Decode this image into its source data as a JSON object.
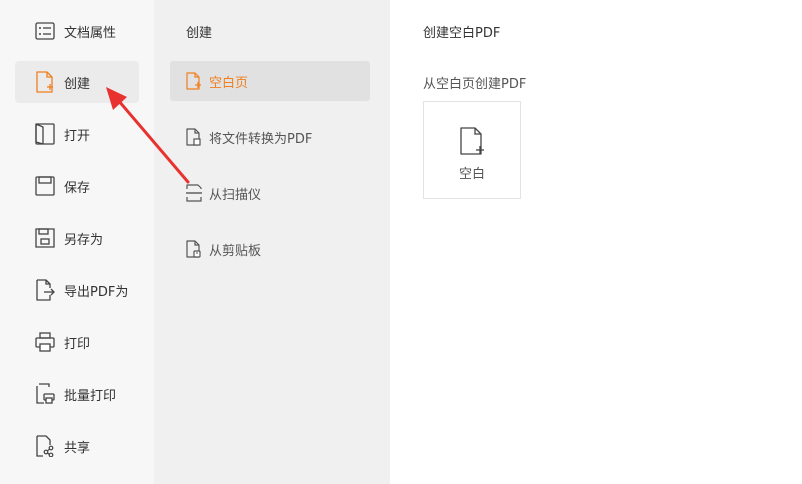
{
  "sidebar": {
    "items": [
      {
        "label": "文档属性",
        "icon": "document-properties-icon"
      },
      {
        "label": "创建",
        "icon": "create-file-icon",
        "active": true
      },
      {
        "label": "打开",
        "icon": "open-book-icon"
      },
      {
        "label": "保存",
        "icon": "save-icon"
      },
      {
        "label": "另存为",
        "icon": "save-as-icon"
      },
      {
        "label": "导出PDF为",
        "icon": "export-icon"
      },
      {
        "label": "打印",
        "icon": "print-icon"
      },
      {
        "label": "批量打印",
        "icon": "batch-print-icon"
      },
      {
        "label": "共享",
        "icon": "share-icon"
      }
    ]
  },
  "submenu": {
    "title": "创建",
    "items": [
      {
        "label": "空白页",
        "icon": "blank-page-icon",
        "active": true
      },
      {
        "label": "将文件转换为PDF",
        "icon": "convert-file-icon"
      },
      {
        "label": "从扫描仪",
        "icon": "scanner-icon"
      },
      {
        "label": "从剪贴板",
        "icon": "clipboard-icon"
      }
    ]
  },
  "content": {
    "title": "创建空白PDF",
    "subtitle": "从空白页创建PDF",
    "blank_card_label": "空白"
  },
  "colors": {
    "accent": "#f07f1e",
    "annotation_arrow": "#e8322f",
    "sidebar_bg": "#f7f7f7",
    "submenu_bg": "#f0f0f0"
  }
}
